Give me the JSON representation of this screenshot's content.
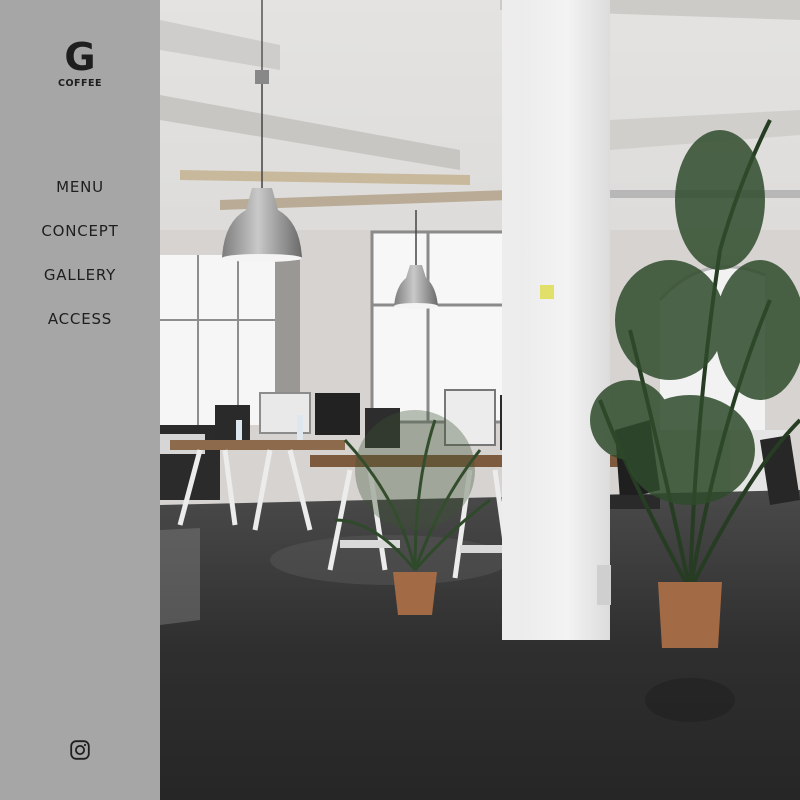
{
  "brand": {
    "mark": "G",
    "name": "COFFEE"
  },
  "nav": {
    "items": [
      {
        "label": "MENU"
      },
      {
        "label": "CONCEPT"
      },
      {
        "label": "GALLERY"
      },
      {
        "label": "ACCESS"
      }
    ]
  },
  "social": {
    "icon": "instagram-icon"
  },
  "colors": {
    "sidebar": "#a6a6a6",
    "text": "#1e1e1e"
  }
}
